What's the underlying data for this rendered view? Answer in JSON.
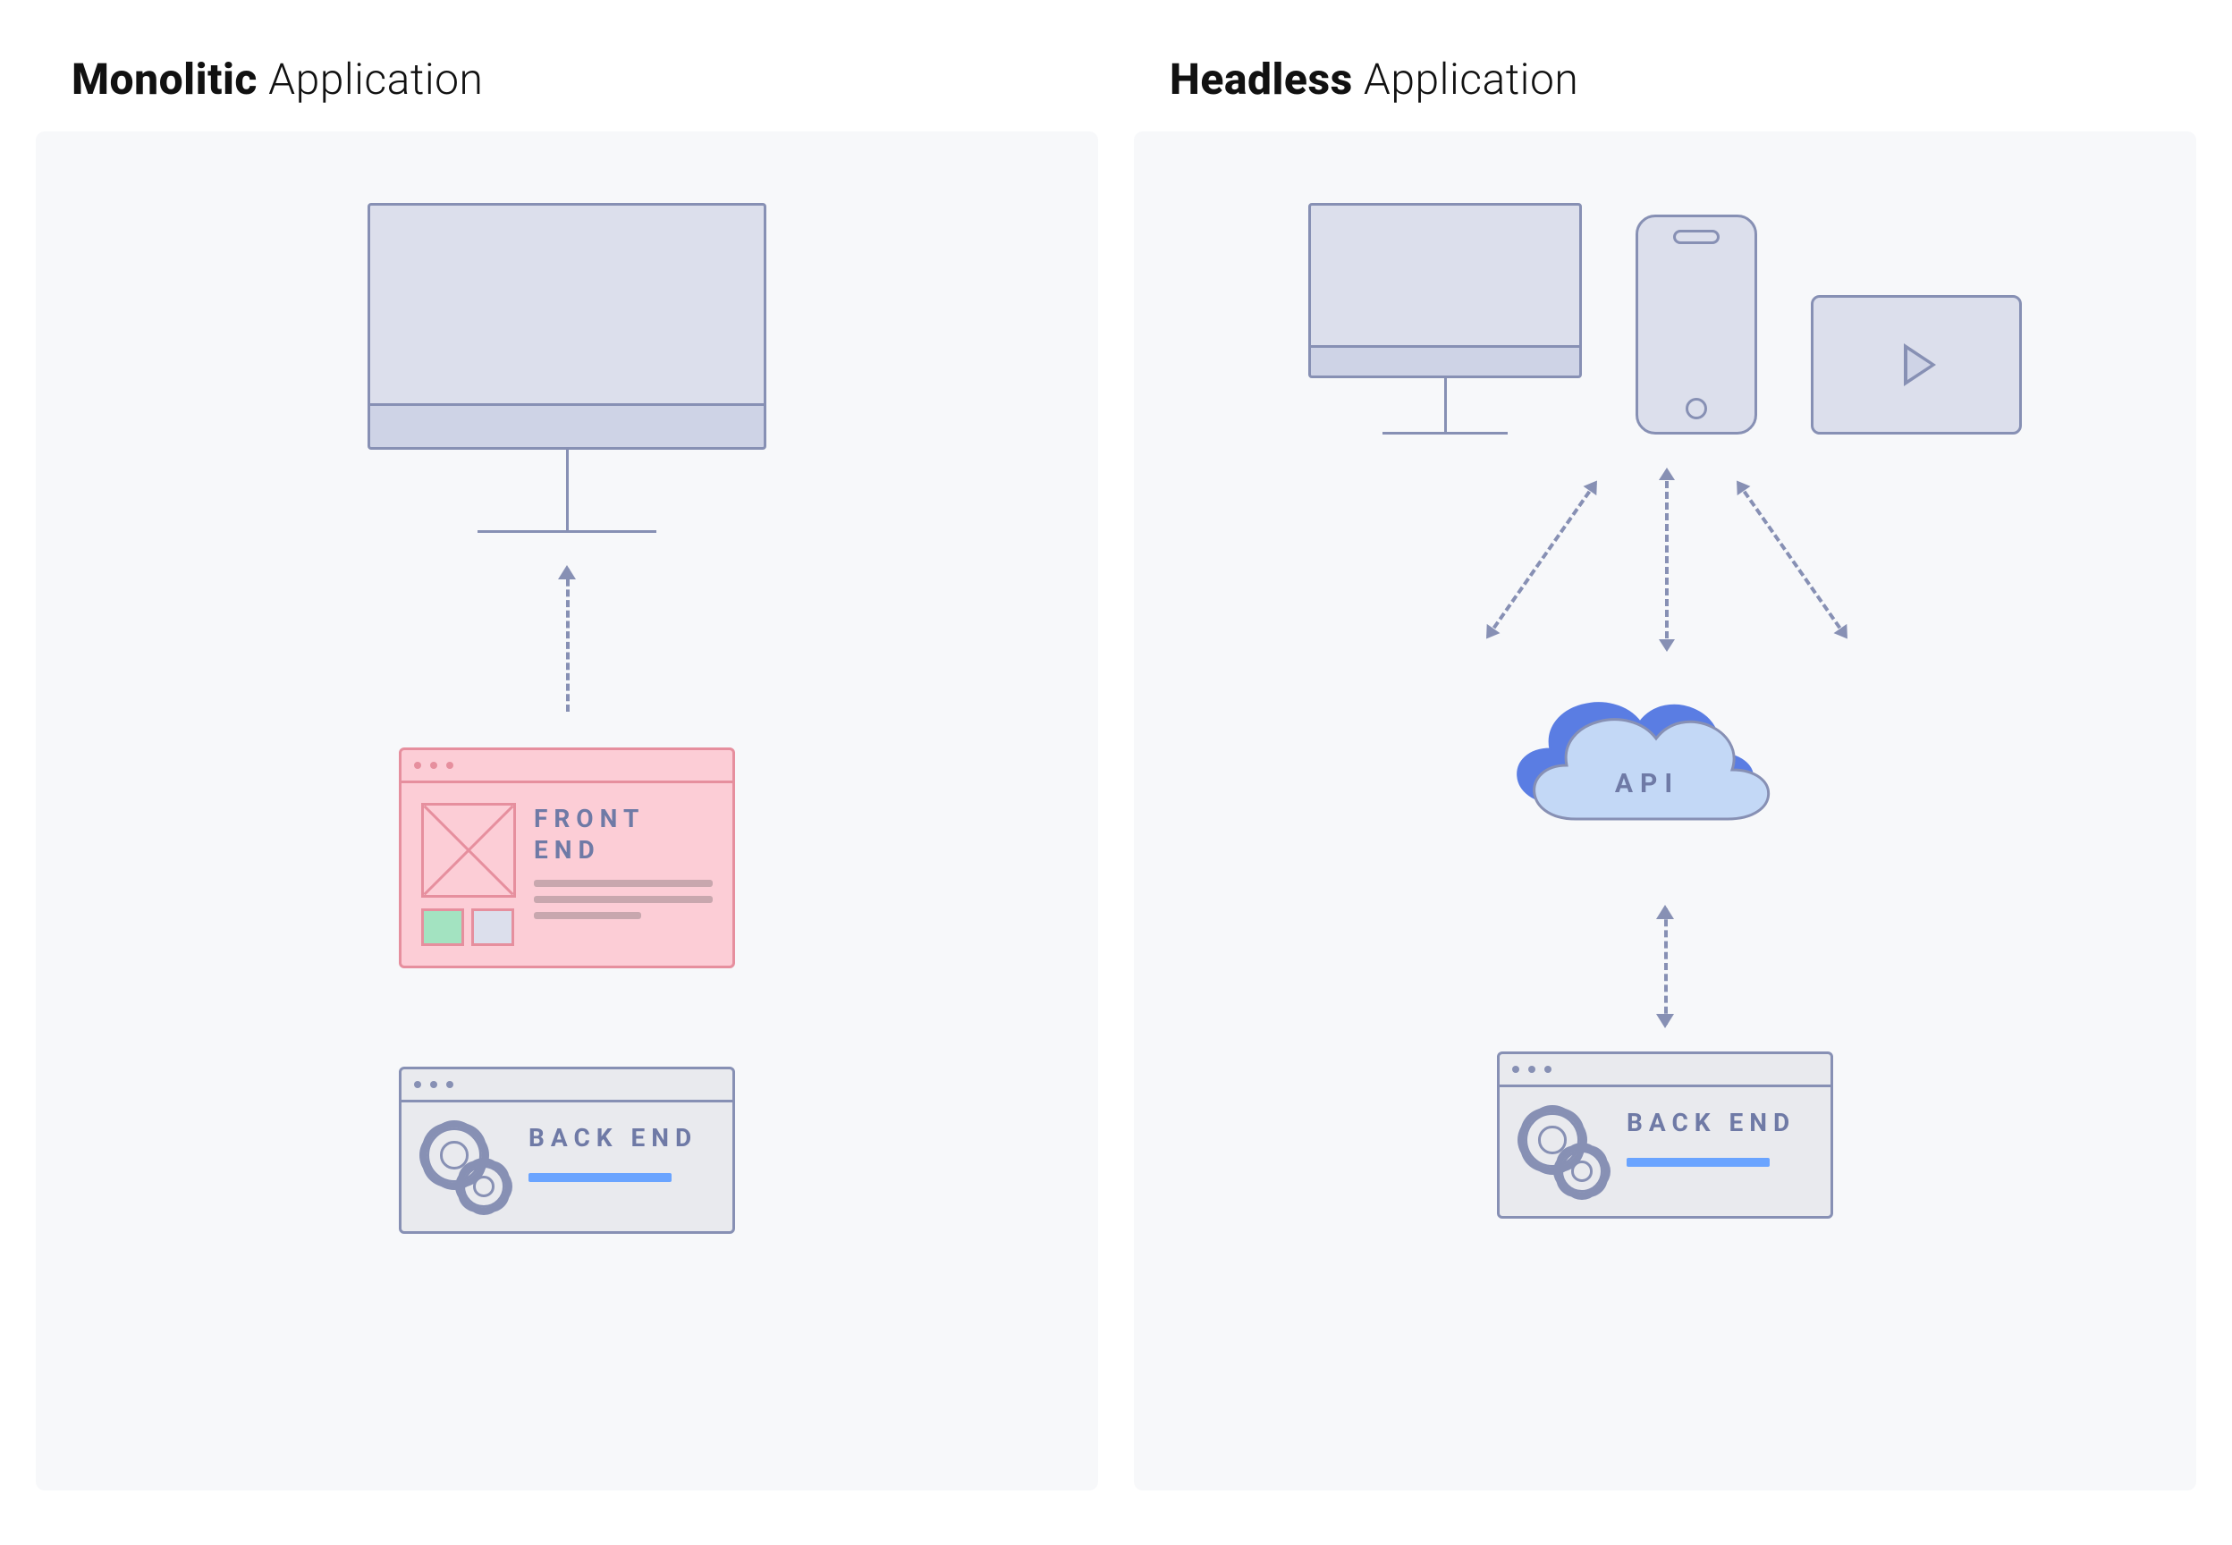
{
  "left": {
    "title_bold": "Monolitic",
    "title_light": " Application",
    "frontend_label": "FRONT END",
    "backend_label": "BACK END"
  },
  "right": {
    "title_bold": "Headless",
    "title_light": " Application",
    "api_label": "API",
    "backend_label": "BACK END"
  }
}
